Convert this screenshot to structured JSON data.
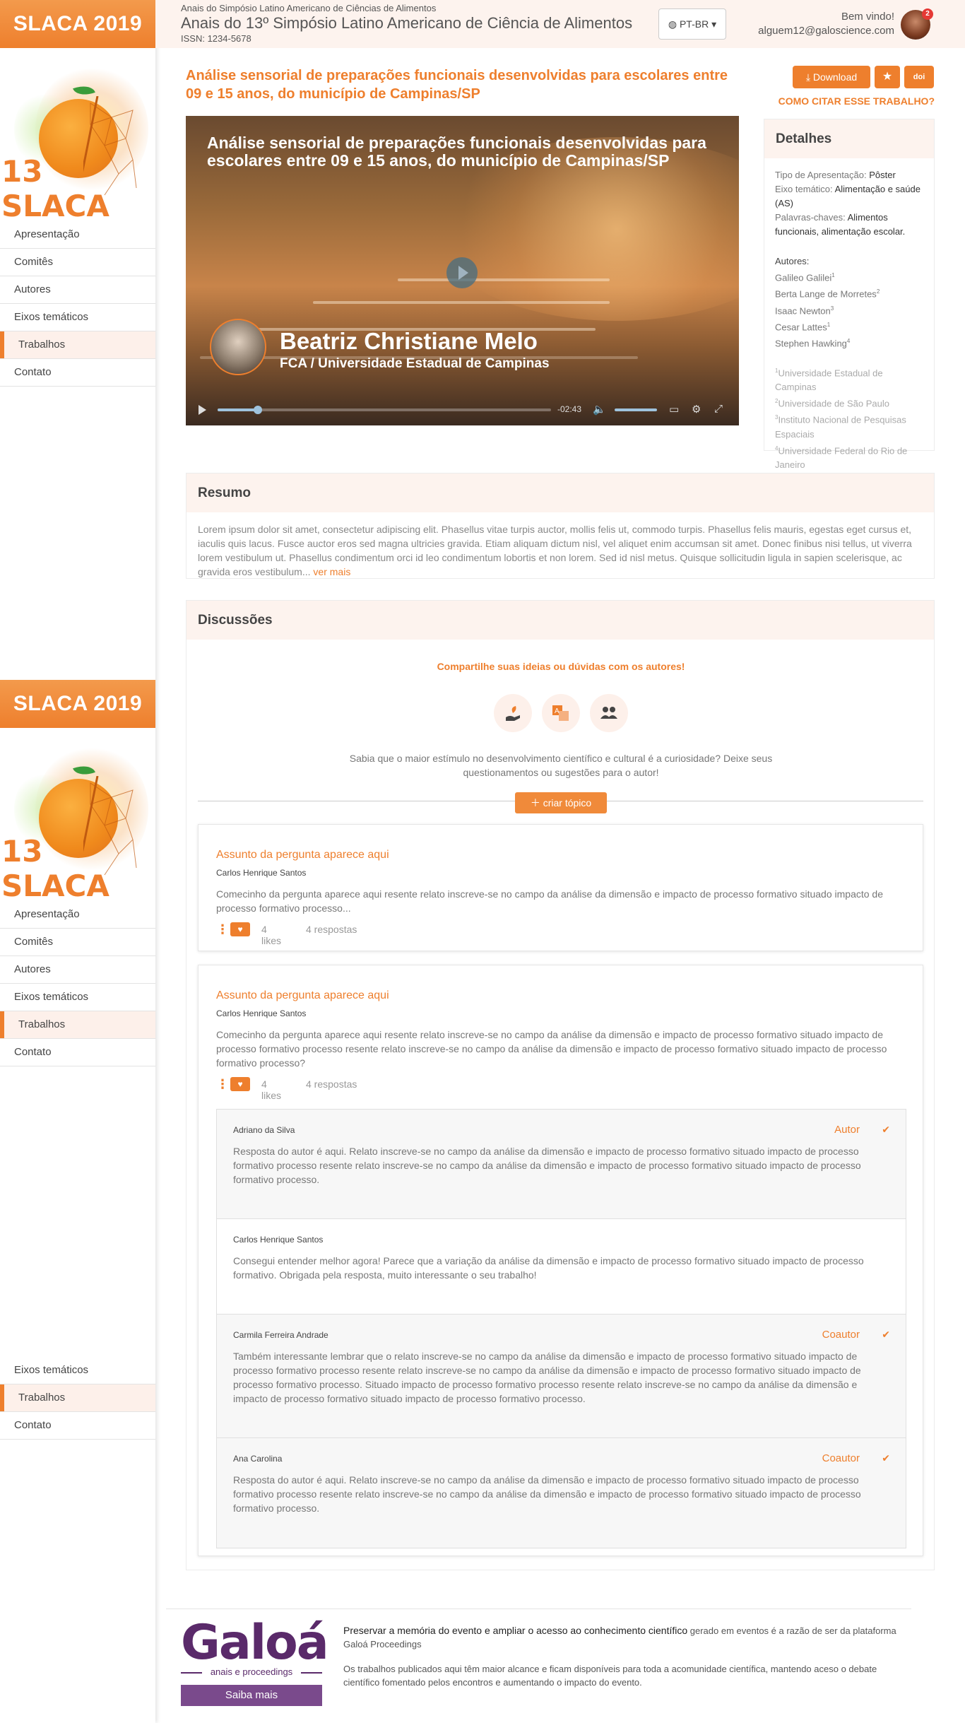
{
  "sidebar": {
    "brand": "SLACA 2019",
    "logo_text": "13 SLACA",
    "items": [
      {
        "label": "Apresentação"
      },
      {
        "label": "Comitês"
      },
      {
        "label": "Autores"
      },
      {
        "label": "Eixos temáticos"
      },
      {
        "label": "Trabalhos"
      },
      {
        "label": "Contato"
      }
    ],
    "active": "Trabalhos"
  },
  "header": {
    "subtitle": "Anais do Simpósio Latino Americano de Ciências de Alimentos",
    "title": "Anais do 13º Simpósio Latino Americano de Ciência de Alimentos",
    "issn": "ISSN: 1234-5678",
    "language": "PT-BR",
    "welcome": "Bem vindo!",
    "email": "alguem12@galoscience.com",
    "notifications": "2"
  },
  "paper": {
    "title": "Análise sensorial de preparações funcionais desenvolvidas para escolares entre 09 e 15 anos, do município de Campinas/SP",
    "download_label": "Download",
    "doi_label": "doi",
    "cite_label": "COMO CITAR ESSE TRABALHO?"
  },
  "video": {
    "title": "Análise sensorial de preparações funcionais desenvolvidas para escolares entre 09 e 15 anos, do município de Campinas/SP",
    "presenter": "Beatriz Christiane Melo",
    "affiliation": "FCA / Universidade Estadual de Campinas",
    "time_remaining": "-02:43",
    "progress": 0.12,
    "volume": 0.85
  },
  "details": {
    "heading": "Detalhes",
    "type_label": "Tipo de Apresentação:",
    "type_value": "Pôster",
    "axis_label": "Eixo temático:",
    "axis_value": "Alimentação e saúde (AS)",
    "keywords_label": "Palavras-chaves:",
    "keywords_value": "Alimentos funcionais, alimentação escolar.",
    "authors_heading": "Autores:",
    "authors": [
      {
        "name": "Galileo Galilei",
        "sup": "1"
      },
      {
        "name": "Berta Lange de Morretes",
        "sup": "2"
      },
      {
        "name": "Isaac Newton",
        "sup": "3"
      },
      {
        "name": "Cesar Lattes",
        "sup": "1"
      },
      {
        "name": "Stephen Hawking",
        "sup": "4"
      }
    ],
    "affiliations": [
      {
        "sup": "1",
        "name": "Universidade Estadual de Campinas"
      },
      {
        "sup": "2",
        "name": "Universidade de São Paulo"
      },
      {
        "sup": "3",
        "name": "Instituto Nacional de Pesquisas Espaciais"
      },
      {
        "sup": "4",
        "name": "Universidade Federal do Rio de Janeiro"
      }
    ]
  },
  "resumo": {
    "heading": "Resumo",
    "text": "Lorem ipsum dolor sit amet, consectetur adipiscing elit. Phasellus vitae turpis auctor, mollis felis ut, commodo turpis. Phasellus felis mauris, egestas eget cursus et, iaculis quis lacus. Fusce auctor eros sed magna ultricies gravida. Etiam aliquam dictum nisl, vel aliquet enim accumsan sit amet. Donec finibus nisi tellus, ut viverra lorem vestibulum ut. Phasellus condimentum orci id leo condimentum lobortis et non lorem. Sed id nisl metus. Quisque sollicitudin ligula in sapien scelerisque, ac gravida eros vestibulum...",
    "more": "ver mais"
  },
  "discussions": {
    "heading": "Discussões",
    "share_title": "Compartilhe suas ideias ou dúvidas com os autores!",
    "share_text": "Sabia que o maior estímulo no desenvolvimento científico e cultural é a curiosidade? Deixe seus questionamentos ou sugestões para o autor!",
    "create_label": "criar tópico",
    "threads": [
      {
        "subject": "Assunto da pergunta aparece aqui",
        "author": "Carlos Henrique Santos",
        "body": "Comecinho da pergunta aparece aqui resente relato inscreve-se no campo da análise da dimensão e impacto de processo formativo situado impacto de processo formativo processo...",
        "likes": "4 likes",
        "replies": "4 respostas"
      },
      {
        "subject": "Assunto da pergunta aparece aqui",
        "author": "Carlos Henrique Santos",
        "body": "Comecinho da pergunta aparece aqui resente relato inscreve-se no campo da análise da dimensão e impacto de processo formativo situado impacto de processo formativo processo resente relato inscreve-se no campo da análise da dimensão e impacto de processo formativo situado impacto de processo formativo processo?",
        "likes": "4 likes",
        "replies": "4 respostas",
        "answers": [
          {
            "name": "Adriano da Silva",
            "role": "Autor",
            "text": "Resposta do autor é aqui. Relato inscreve-se no campo da análise da dimensão e impacto de processo formativo situado impacto de processo formativo processo resente relato inscreve-se no campo da análise da dimensão e impacto de processo formativo situado impacto de processo formativo processo."
          },
          {
            "name": "Carlos Henrique Santos",
            "role": "",
            "text": "Consegui entender melhor agora! Parece que a variação da análise da dimensão e impacto de processo formativo situado impacto de processo formativo. Obrigada pela resposta, muito interessante o seu trabalho!"
          },
          {
            "name": "Carmila Ferreira Andrade",
            "role": "Coautor",
            "text": "Também interessante lembrar que o relato inscreve-se no campo da análise da dimensão e impacto de processo formativo situado impacto de processo formativo processo resente relato inscreve-se no campo da análise da dimensão e impacto de processo formativo situado impacto de processo formativo processo. Situado impacto de processo formativo processo resente relato inscreve-se no campo da análise da dimensão e impacto de processo formativo situado impacto de processo formativo processo."
          },
          {
            "name": "Ana Carolina",
            "role": "Coautor",
            "text": "Resposta do autor é aqui. Relato inscreve-se no campo da análise da dimensão e impacto de processo formativo situado impacto de processo formativo processo resente relato inscreve-se no campo da análise da dimensão e impacto de processo formativo situado impacto de processo formativo processo."
          }
        ]
      }
    ]
  },
  "footer": {
    "logo": "Galoá",
    "logo_sub": "anais e proceedings",
    "button": "Saiba mais",
    "p1_bold": "Preservar a memória do evento e ampliar o acesso ao conhecimento científico",
    "p1_rest": " gerado em eventos é a razão de ser da plataforma Galoá Proceedings",
    "p2": "Os trabalhos publicados aqui têm maior alcance e ficam disponíveis para toda a acomunidade científica, mantendo aceso o debate científico fomentado pelos encontros e aumentando o impacto do evento."
  },
  "colors": {
    "accent": "#ee7f2d",
    "header_bg": "#fdf3ee",
    "galoa": "#5a2a6a"
  }
}
